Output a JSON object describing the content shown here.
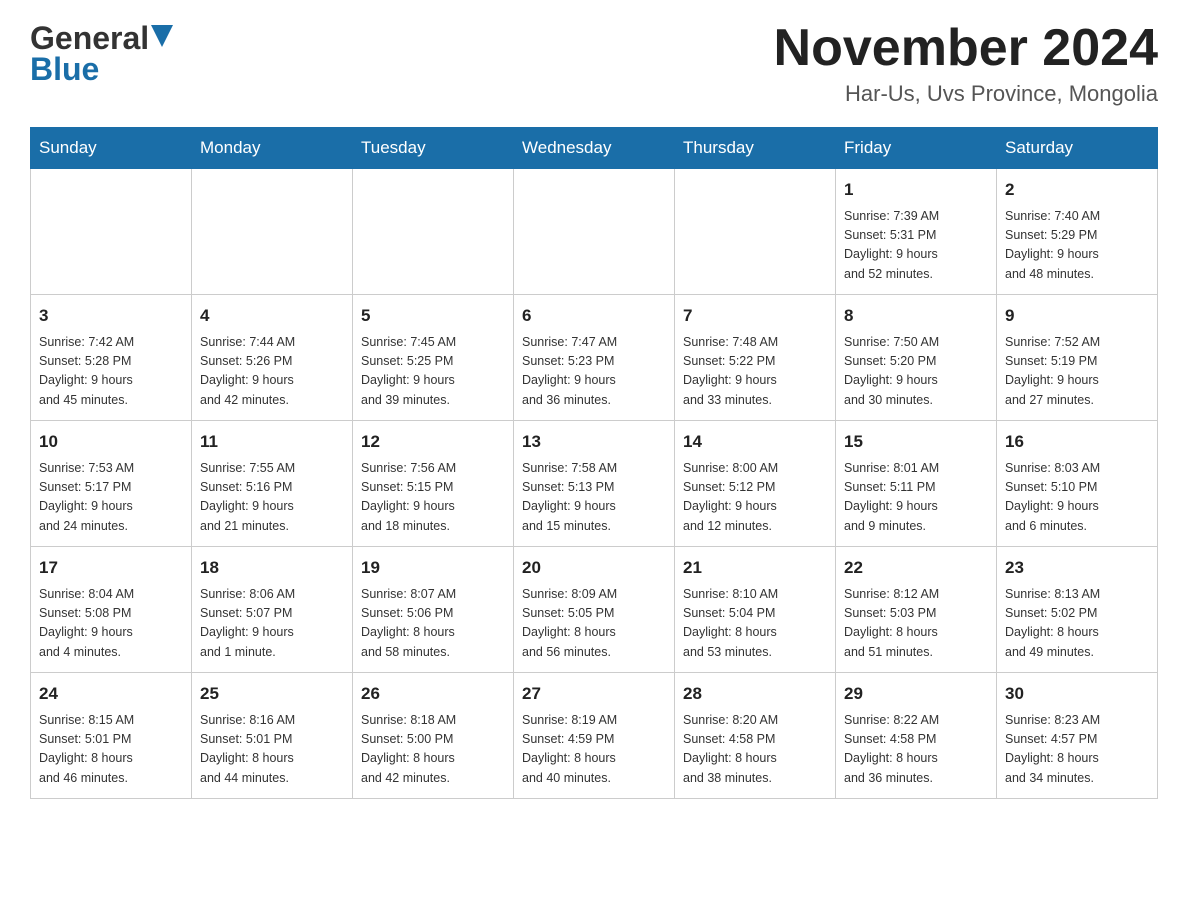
{
  "header": {
    "logo_general": "General",
    "logo_blue": "Blue",
    "title": "November 2024",
    "subtitle": "Har-Us, Uvs Province, Mongolia"
  },
  "weekdays": [
    "Sunday",
    "Monday",
    "Tuesday",
    "Wednesday",
    "Thursday",
    "Friday",
    "Saturday"
  ],
  "weeks": [
    [
      {
        "day": "",
        "info": ""
      },
      {
        "day": "",
        "info": ""
      },
      {
        "day": "",
        "info": ""
      },
      {
        "day": "",
        "info": ""
      },
      {
        "day": "",
        "info": ""
      },
      {
        "day": "1",
        "info": "Sunrise: 7:39 AM\nSunset: 5:31 PM\nDaylight: 9 hours\nand 52 minutes."
      },
      {
        "day": "2",
        "info": "Sunrise: 7:40 AM\nSunset: 5:29 PM\nDaylight: 9 hours\nand 48 minutes."
      }
    ],
    [
      {
        "day": "3",
        "info": "Sunrise: 7:42 AM\nSunset: 5:28 PM\nDaylight: 9 hours\nand 45 minutes."
      },
      {
        "day": "4",
        "info": "Sunrise: 7:44 AM\nSunset: 5:26 PM\nDaylight: 9 hours\nand 42 minutes."
      },
      {
        "day": "5",
        "info": "Sunrise: 7:45 AM\nSunset: 5:25 PM\nDaylight: 9 hours\nand 39 minutes."
      },
      {
        "day": "6",
        "info": "Sunrise: 7:47 AM\nSunset: 5:23 PM\nDaylight: 9 hours\nand 36 minutes."
      },
      {
        "day": "7",
        "info": "Sunrise: 7:48 AM\nSunset: 5:22 PM\nDaylight: 9 hours\nand 33 minutes."
      },
      {
        "day": "8",
        "info": "Sunrise: 7:50 AM\nSunset: 5:20 PM\nDaylight: 9 hours\nand 30 minutes."
      },
      {
        "day": "9",
        "info": "Sunrise: 7:52 AM\nSunset: 5:19 PM\nDaylight: 9 hours\nand 27 minutes."
      }
    ],
    [
      {
        "day": "10",
        "info": "Sunrise: 7:53 AM\nSunset: 5:17 PM\nDaylight: 9 hours\nand 24 minutes."
      },
      {
        "day": "11",
        "info": "Sunrise: 7:55 AM\nSunset: 5:16 PM\nDaylight: 9 hours\nand 21 minutes."
      },
      {
        "day": "12",
        "info": "Sunrise: 7:56 AM\nSunset: 5:15 PM\nDaylight: 9 hours\nand 18 minutes."
      },
      {
        "day": "13",
        "info": "Sunrise: 7:58 AM\nSunset: 5:13 PM\nDaylight: 9 hours\nand 15 minutes."
      },
      {
        "day": "14",
        "info": "Sunrise: 8:00 AM\nSunset: 5:12 PM\nDaylight: 9 hours\nand 12 minutes."
      },
      {
        "day": "15",
        "info": "Sunrise: 8:01 AM\nSunset: 5:11 PM\nDaylight: 9 hours\nand 9 minutes."
      },
      {
        "day": "16",
        "info": "Sunrise: 8:03 AM\nSunset: 5:10 PM\nDaylight: 9 hours\nand 6 minutes."
      }
    ],
    [
      {
        "day": "17",
        "info": "Sunrise: 8:04 AM\nSunset: 5:08 PM\nDaylight: 9 hours\nand 4 minutes."
      },
      {
        "day": "18",
        "info": "Sunrise: 8:06 AM\nSunset: 5:07 PM\nDaylight: 9 hours\nand 1 minute."
      },
      {
        "day": "19",
        "info": "Sunrise: 8:07 AM\nSunset: 5:06 PM\nDaylight: 8 hours\nand 58 minutes."
      },
      {
        "day": "20",
        "info": "Sunrise: 8:09 AM\nSunset: 5:05 PM\nDaylight: 8 hours\nand 56 minutes."
      },
      {
        "day": "21",
        "info": "Sunrise: 8:10 AM\nSunset: 5:04 PM\nDaylight: 8 hours\nand 53 minutes."
      },
      {
        "day": "22",
        "info": "Sunrise: 8:12 AM\nSunset: 5:03 PM\nDaylight: 8 hours\nand 51 minutes."
      },
      {
        "day": "23",
        "info": "Sunrise: 8:13 AM\nSunset: 5:02 PM\nDaylight: 8 hours\nand 49 minutes."
      }
    ],
    [
      {
        "day": "24",
        "info": "Sunrise: 8:15 AM\nSunset: 5:01 PM\nDaylight: 8 hours\nand 46 minutes."
      },
      {
        "day": "25",
        "info": "Sunrise: 8:16 AM\nSunset: 5:01 PM\nDaylight: 8 hours\nand 44 minutes."
      },
      {
        "day": "26",
        "info": "Sunrise: 8:18 AM\nSunset: 5:00 PM\nDaylight: 8 hours\nand 42 minutes."
      },
      {
        "day": "27",
        "info": "Sunrise: 8:19 AM\nSunset: 4:59 PM\nDaylight: 8 hours\nand 40 minutes."
      },
      {
        "day": "28",
        "info": "Sunrise: 8:20 AM\nSunset: 4:58 PM\nDaylight: 8 hours\nand 38 minutes."
      },
      {
        "day": "29",
        "info": "Sunrise: 8:22 AM\nSunset: 4:58 PM\nDaylight: 8 hours\nand 36 minutes."
      },
      {
        "day": "30",
        "info": "Sunrise: 8:23 AM\nSunset: 4:57 PM\nDaylight: 8 hours\nand 34 minutes."
      }
    ]
  ]
}
